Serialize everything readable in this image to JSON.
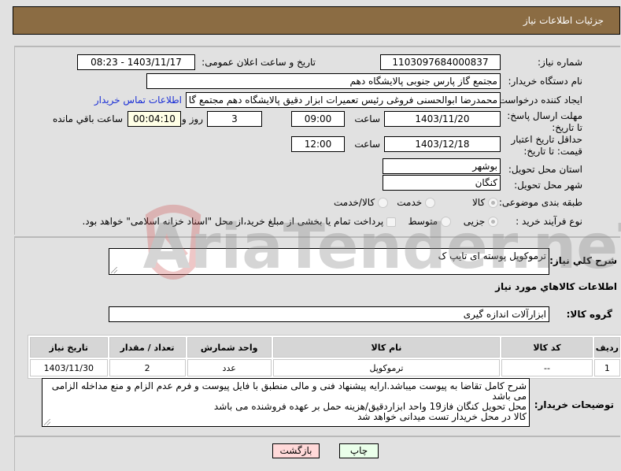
{
  "header": {
    "title": "جزئیات اطلاعات نیاز"
  },
  "fields": {
    "need_number_label": "شماره نیاز:",
    "need_number": "1103097684000837",
    "announce_label": "تاریخ و ساعت اعلان عمومی:",
    "announce_value": "1403/11/17 - 08:23",
    "buyer_org_label": "نام دستگاه خریدار:",
    "buyer_org": "مجتمع گاز پارس جنوبی  پالایشگاه دهم",
    "creator_label": "ایجاد کننده درخواست:",
    "creator": "محمدرضا ابوالحسنی فروغی رئیس تعمیرات ابزار دقیق پالایشگاه دهم  مجتمع گا",
    "contact_link": "اطلاعات تماس خریدار",
    "deadline_label": "مهلت ارسال پاسخ: تا تاریخ:",
    "deadline_date": "1403/11/20",
    "hour_label": "ساعت",
    "deadline_time": "09:00",
    "days_value": "3",
    "days_label": "روز و",
    "remaining_time": "00:04:10",
    "remaining_label": "ساعت باقي مانده",
    "validity_label": "حداقل تاریخ اعتبار قیمت: تا تاریخ:",
    "validity_date": "1403/12/18",
    "validity_time": "12:00",
    "province_label": "استان محل تحویل:",
    "province": "بوشهر",
    "city_label": "شهر محل تحویل:",
    "city": "کنگان",
    "category_label": "طبقه بندی موضوعی:",
    "category_options": [
      "کالا",
      "خدمت",
      "کالا/خدمت"
    ],
    "category_selected": "کالا",
    "process_label": "نوع فرآیند خرید :",
    "process_options": [
      "جزیی",
      "متوسط"
    ],
    "process_selected": "جزیی",
    "treasury_note": "پرداخت تمام یا بخشی از مبلغ خرید،از محل \"اسناد خزانه اسلامی\" خواهد بود."
  },
  "details": {
    "summary_label": "شرح کلي نياز:",
    "summary": "ترموکوپل پوسته ای تایپ ک",
    "goods_info_title": "اطلاعات کالاهاي مورد نياز",
    "goods_group_label": "گروه کالا:",
    "goods_group": "ابزارآلات اندازه گیری",
    "table": {
      "headers": [
        "ردیف",
        "کد کالا",
        "نام کالا",
        "واحد شمارش",
        "تعداد / مقدار",
        "تاریخ نیاز"
      ],
      "rows": [
        [
          "1",
          "--",
          "ترموکوپل",
          "عدد",
          "2",
          "1403/11/30"
        ]
      ]
    },
    "buyer_notes_label": "توضیحات خریدار:",
    "buyer_notes": [
      "شرح کامل تقاضا به پیوست میباشد.ارایه پیشنهاد فنی و مالی منطبق با فایل پیوست و فرم عدم الزام و منع مداخله الزامی می باشد",
      "محل تحویل کنگان فاز19 واحد ابزاردقیق/هزینه حمل بر عهده فروشنده می باشد",
      "کالا در محل خریدار تست میدانی خواهد شد"
    ]
  },
  "buttons": {
    "print": "چاپ",
    "back": "بازگشت"
  },
  "watermark": "AriaTender.neT"
}
